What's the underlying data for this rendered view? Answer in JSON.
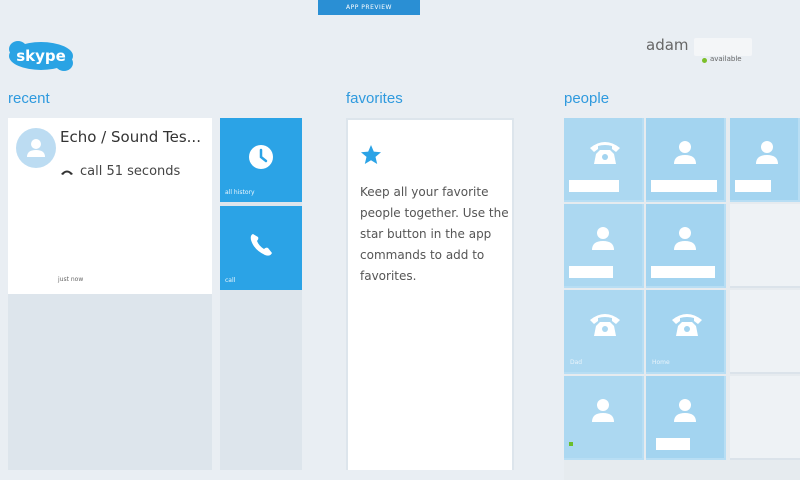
{
  "banner": {
    "label": "APP PREVIEW"
  },
  "app": {
    "logo_text": "skype",
    "accent": "#2ba3e6",
    "title_color": "#2f9ade"
  },
  "user": {
    "name": "adam",
    "status": "available",
    "status_color": "#7cbf2a"
  },
  "sections": {
    "recent": "recent",
    "favorites": "favorites",
    "people": "people"
  },
  "recent": {
    "contact_name": "Echo / Sound Tes...",
    "call_info": "call 51 seconds",
    "timestamp": "just now",
    "avatar_icon": "person-icon",
    "tiles": [
      {
        "label": "all history",
        "icon": "clock-icon"
      },
      {
        "label": "call",
        "icon": "phone-icon"
      }
    ]
  },
  "favorites": {
    "icon": "star-icon",
    "message": "Keep all your favorite people together. Use the star button in the app commands to add to favorites."
  },
  "people": {
    "tiles": [
      {
        "icon": "landline-phone-icon",
        "label": ""
      },
      {
        "icon": "person-icon",
        "label": ""
      },
      {
        "icon": "person-icon",
        "label": ""
      },
      {
        "icon": "person-icon",
        "label": ""
      },
      {
        "icon": "person-icon",
        "label": ""
      },
      {
        "icon": "landline-phone-icon",
        "label": "Dad"
      },
      {
        "icon": "landline-phone-icon",
        "label": "Home"
      },
      {
        "icon": "person-icon",
        "label": ""
      },
      {
        "icon": "person-icon",
        "label": ""
      }
    ]
  }
}
